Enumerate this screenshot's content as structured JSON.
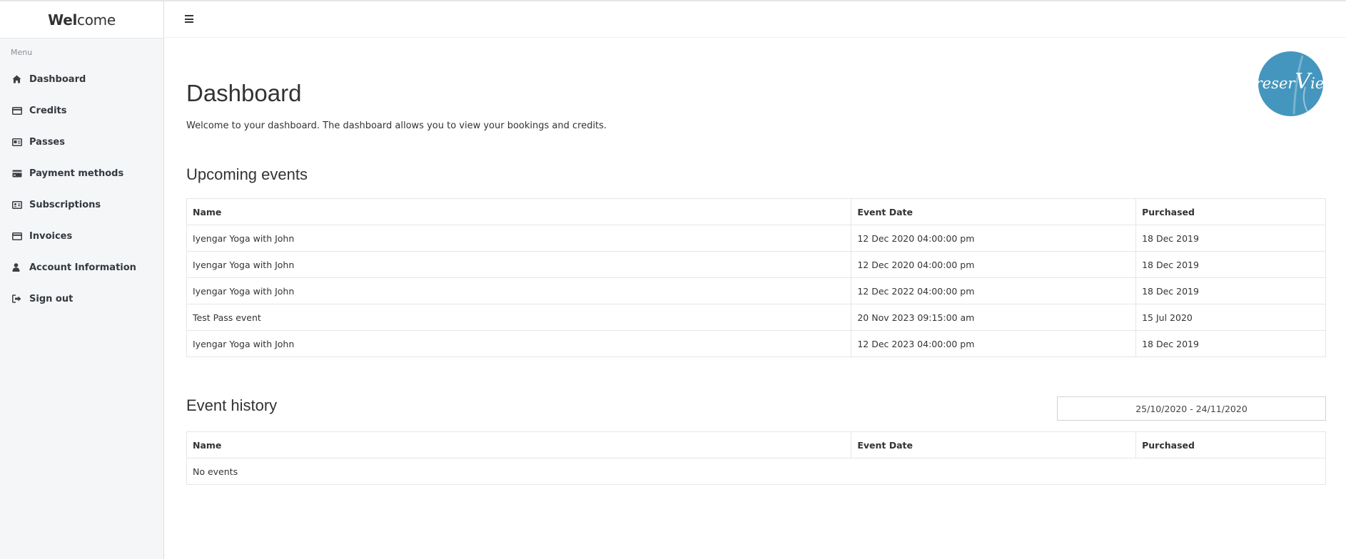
{
  "brand": {
    "bold": "Wel",
    "light": "come"
  },
  "sidebar": {
    "menu_label": "Menu",
    "items": [
      {
        "label": "Dashboard",
        "icon": "home-icon"
      },
      {
        "label": "Credits",
        "icon": "credit-card-icon"
      },
      {
        "label": "Passes",
        "icon": "id-card-icon"
      },
      {
        "label": "Payment methods",
        "icon": "credit-card-icon"
      },
      {
        "label": "Subscriptions",
        "icon": "address-card-icon"
      },
      {
        "label": "Invoices",
        "icon": "credit-card-icon"
      },
      {
        "label": "Account Information",
        "icon": "user-icon"
      },
      {
        "label": "Sign out",
        "icon": "sign-out-icon"
      }
    ]
  },
  "logo": {
    "text": "reserVie",
    "color": "#4596be"
  },
  "page": {
    "title": "Dashboard",
    "subtitle": "Welcome to your dashboard. The dashboard allows you to view your bookings and credits."
  },
  "upcoming": {
    "title": "Upcoming events",
    "columns": [
      "Name",
      "Event Date",
      "Purchased"
    ],
    "rows": [
      [
        "Iyengar Yoga with John",
        "12 Dec 2020 04:00:00 pm",
        "18 Dec 2019"
      ],
      [
        "Iyengar Yoga with John",
        "12 Dec 2020 04:00:00 pm",
        "18 Dec 2019"
      ],
      [
        "Iyengar Yoga with John",
        "12 Dec 2022 04:00:00 pm",
        "18 Dec 2019"
      ],
      [
        "Test Pass event",
        "20 Nov 2023 09:15:00 am",
        "15 Jul 2020"
      ],
      [
        "Iyengar Yoga with John",
        "12 Dec 2023 04:00:00 pm",
        "18 Dec 2019"
      ]
    ]
  },
  "history": {
    "title": "Event history",
    "date_range": "25/10/2020 - 24/11/2020",
    "columns": [
      "Name",
      "Event Date",
      "Purchased"
    ],
    "empty": "No events"
  }
}
